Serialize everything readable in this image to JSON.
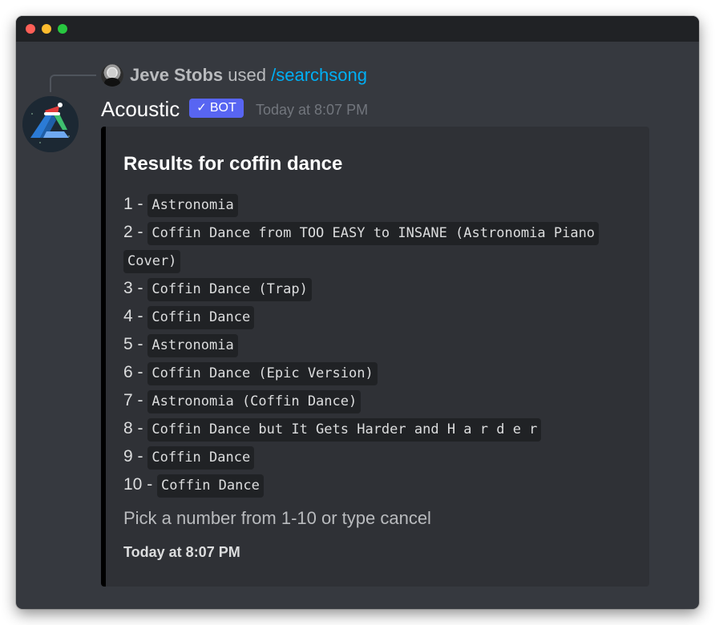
{
  "window": {
    "controls": [
      "close",
      "minimize",
      "maximize"
    ]
  },
  "reply": {
    "user": "Jeve Stobs",
    "used": "used",
    "command": "/searchsong"
  },
  "message": {
    "author": "Acoustic",
    "bot_badge": "BOT",
    "timestamp": "Today at 8:07 PM"
  },
  "embed": {
    "title": "Results for coffin dance",
    "accent_color": "#000000",
    "results": [
      {
        "num": "1 -",
        "title": "Astronomia"
      },
      {
        "num": "2 -",
        "title": "Coffin Dance from TOO EASY to INSANE (Astronomia Piano Cover)"
      },
      {
        "num": "3 -",
        "title": "Coffin Dance (Trap)"
      },
      {
        "num": "4 -",
        "title": "Coffin Dance"
      },
      {
        "num": "5 -",
        "title": "Astronomia"
      },
      {
        "num": "6 -",
        "title": "Coffin Dance (Epic Version)"
      },
      {
        "num": "7 -",
        "title": "Astronomia (Coffin Dance)"
      },
      {
        "num": "8 -",
        "title": "Coffin Dance but It Gets Harder and H a r d e r"
      },
      {
        "num": "9 -",
        "title": "Coffin Dance"
      },
      {
        "num": "10 -",
        "title": "Coffin Dance"
      }
    ],
    "footer_prompt": "Pick a number from 1-10 or type cancel",
    "footer_time": "Today at 8:07 PM"
  },
  "colors": {
    "background": "#36393f",
    "embed_background": "#2f3136",
    "bot_badge": "#5865f2",
    "command_link": "#00aff4"
  }
}
